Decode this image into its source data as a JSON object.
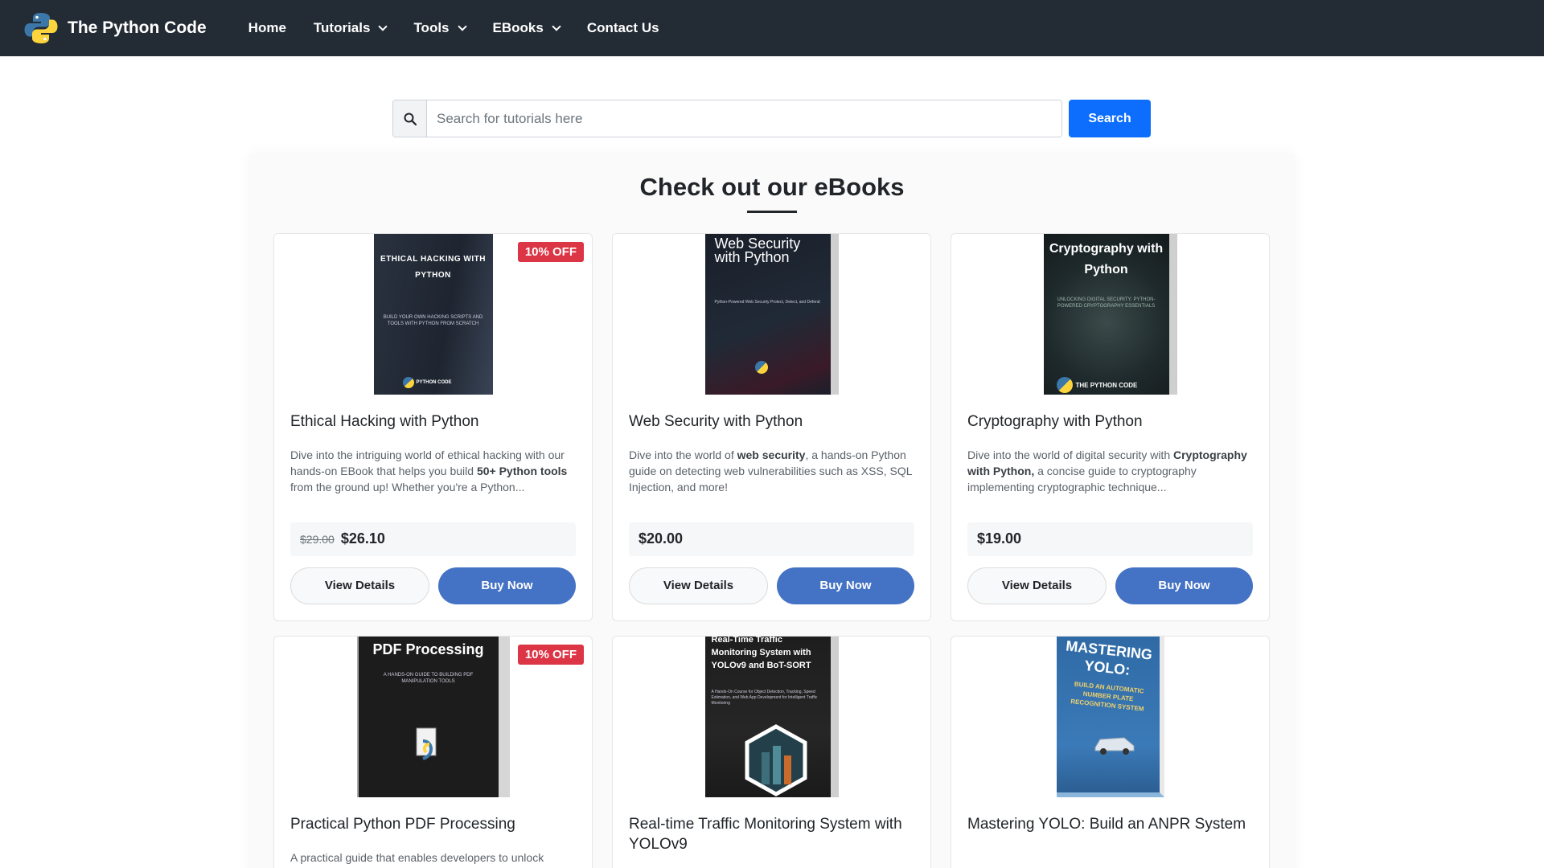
{
  "brand": {
    "name": "The Python Code",
    "logo_icon": "python-logo-icon"
  },
  "nav": {
    "home": "Home",
    "tutorials": "Tutorials",
    "tools": "Tools",
    "ebooks": "EBooks",
    "contact": "Contact Us"
  },
  "search": {
    "placeholder": "Search for tutorials here",
    "button": "Search",
    "icon": "search-icon"
  },
  "section": {
    "title": "Check out our eBooks"
  },
  "colors": {
    "navbar": "#232b34",
    "search_button": "#0d6efd",
    "buy_button": "#4472c4",
    "badge": "#dc3545"
  },
  "books": [
    {
      "cover_title": "ETHICAL HACKING WITH PYTHON",
      "cover_sub": "BUILD YOUR OWN HACKING SCRIPTS AND TOOLS WITH PYTHON FROM SCRATCH",
      "cover_brand": "PYTHON CODE",
      "badge": "10% OFF",
      "title": "Ethical Hacking with Python",
      "desc_1": "Dive into the intriguing world of ethical hacking with our hands-on EBook that helps you build ",
      "desc_bold": "50+ Python tools",
      "desc_2": " from the ground up! Whether you're a Python...",
      "old_price": "$29.00",
      "price": "$26.10",
      "view": "View Details",
      "buy": "Buy Now"
    },
    {
      "cover_title": "Web Security with Python",
      "cover_sub": "Python-Powered Web Security Protect, Detect, and Defend",
      "title": "Web Security with Python",
      "desc_1": "Dive into the world of ",
      "desc_bold": "web security",
      "desc_2": ", a hands-on Python guide on detecting web vulnerabilities such as XSS, SQL Injection, and more!",
      "price": "$20.00",
      "view": "View Details",
      "buy": "Buy Now"
    },
    {
      "cover_title": "Cryptography with Python",
      "cover_sub": "UNLOCKING DIGITAL SECURITY: PYTHON-POWERED CRYPTOGRAPHY ESSENTIALS",
      "cover_brand": "THE PYTHON CODE",
      "title": "Cryptography with Python",
      "desc_1": "Dive into the world of digital security with ",
      "desc_bold": "Cryptography with Python,",
      "desc_2": " a concise guide to cryptography implementing cryptographic technique...",
      "price": "$19.00",
      "view": "View Details",
      "buy": "Buy Now"
    },
    {
      "cover_title": "PDF Processing",
      "cover_sub": "A HANDS-ON GUIDE TO BUILDING PDF MANIPULATION TOOLS",
      "badge": "10% OFF",
      "title": "Practical Python PDF Processing",
      "desc_1": "A practical guide that enables developers to unlock"
    },
    {
      "cover_title": "Real-Time Traffic Monitoring System with YOLOv9 and BoT-SORT",
      "cover_sub": "A Hands-On Course for Object Detection, Tracking, Speed Estimation, and Web App Development for Intelligent Traffic Monitoring",
      "title": "Real-time Traffic Monitoring System with YOLOv9"
    },
    {
      "cover_title": "MASTERING YOLO:",
      "cover_sub": "BUILD AN AUTOMATIC NUMBER PLATE RECOGNITION SYSTEM",
      "title": "Mastering YOLO: Build an ANPR System"
    }
  ]
}
